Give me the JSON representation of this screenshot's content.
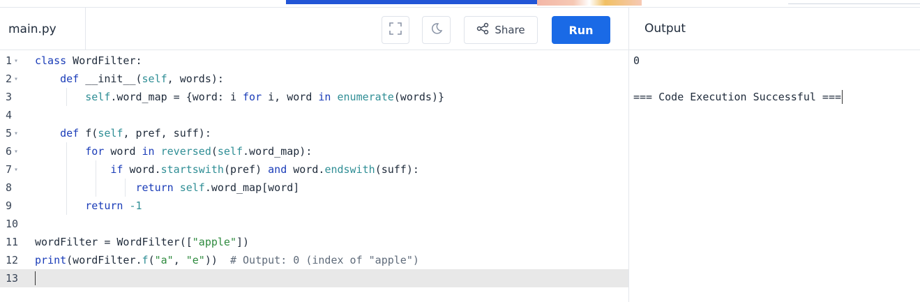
{
  "editor": {
    "filename": "main.py",
    "share_label": "Share",
    "run_label": "Run",
    "icons": {
      "fullscreen": "fullscreen-icon",
      "theme": "moon-icon",
      "share": "share-icon"
    },
    "accent_color": "#1a6ae6",
    "lines": [
      {
        "num": "1",
        "fold": true
      },
      {
        "num": "2",
        "fold": true
      },
      {
        "num": "3",
        "fold": false
      },
      {
        "num": "4",
        "fold": false
      },
      {
        "num": "5",
        "fold": true
      },
      {
        "num": "6",
        "fold": true
      },
      {
        "num": "7",
        "fold": true
      },
      {
        "num": "8",
        "fold": false
      },
      {
        "num": "9",
        "fold": false
      },
      {
        "num": "10",
        "fold": false
      },
      {
        "num": "11",
        "fold": false
      },
      {
        "num": "12",
        "fold": false
      },
      {
        "num": "13",
        "fold": false
      }
    ],
    "code": {
      "l1": {
        "kw": "class",
        "rest": " WordFilter:"
      },
      "l2": {
        "kw": "def",
        "name": " __init__(",
        "self": "self",
        "rest": ", words):"
      },
      "l3": {
        "a": "self",
        "b": ".word_map = {word: i ",
        "kw1": "for",
        "c": " i, word ",
        "kw2": "in",
        "d": " ",
        "bi": "enumerate",
        "e": "(words)}"
      },
      "l5": {
        "kw": "def",
        "name": " f(",
        "self": "self",
        "rest": ", pref, suff):"
      },
      "l6": {
        "kw1": "for",
        "a": " word ",
        "kw2": "in",
        "b": " ",
        "bi": "reversed",
        "c": "(",
        "self": "self",
        "d": ".word_map):"
      },
      "l7": {
        "kw1": "if",
        "a": " word.",
        "bi1": "startswith",
        "b": "(pref) ",
        "kw2": "and",
        "c": " word.",
        "bi2": "endswith",
        "d": "(suff):"
      },
      "l8": {
        "kw": "return",
        "b": " ",
        "self": "self",
        "c": ".word_map[word]"
      },
      "l9": {
        "kw": "return",
        "num": " -1"
      },
      "l11": {
        "a": "wordFilter = WordFilter([",
        "str": "\"apple\"",
        "b": "])"
      },
      "l12": {
        "bi": "print",
        "a": "(wordFilter.",
        "bi2": "f",
        "b": "(",
        "str1": "\"a\"",
        "c": ", ",
        "str2": "\"e\"",
        "d": "))  ",
        "com": "# Output: 0 (index of \"apple\")"
      }
    }
  },
  "output": {
    "title": "Output",
    "line1": "0",
    "line2": "=== Code Execution Successful ==="
  }
}
